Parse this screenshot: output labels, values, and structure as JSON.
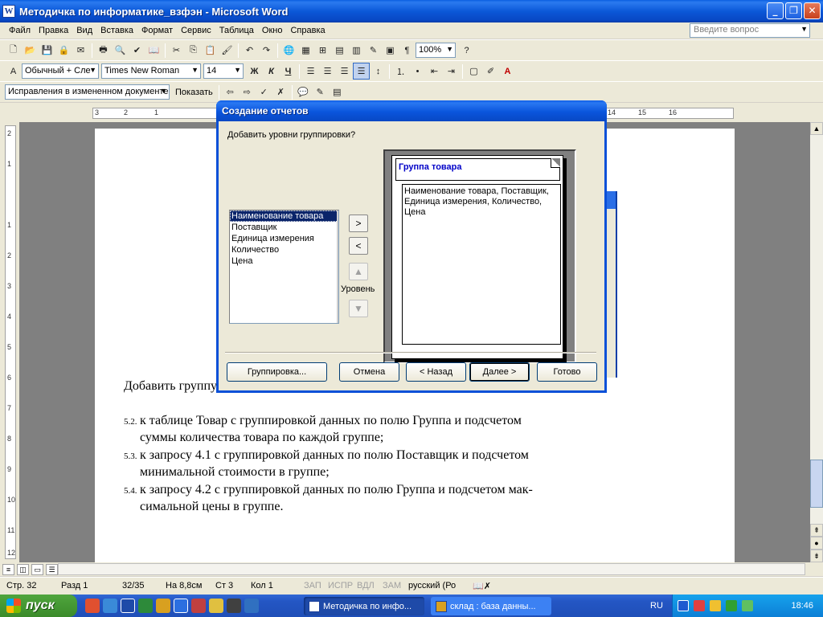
{
  "window": {
    "title": "Методичка по информатике_взфэн - Microsoft Word",
    "app_icon": "W",
    "controls": [
      "_",
      "❐",
      "✕"
    ]
  },
  "menu": {
    "items": [
      "Файл",
      "Правка",
      "Вид",
      "Вставка",
      "Формат",
      "Сервис",
      "Таблица",
      "Окно",
      "Справка"
    ],
    "help_placeholder": "Введите вопрос"
  },
  "toolbar1": {
    "zoom": "100%"
  },
  "toolbar2": {
    "style": "Обычный + Сле",
    "font": "Times New Roman",
    "size": "14",
    "bold": "Ж",
    "italic": "К",
    "underline": "Ч"
  },
  "toolbar3": {
    "track_changes": "Исправления в измененном документе",
    "show_label": "Показать"
  },
  "ruler": {
    "h_numbers": [
      "3",
      "2",
      "1",
      "14",
      "15",
      "16"
    ],
    "v_numbers": [
      "2",
      "1",
      "1",
      "2",
      "3",
      "4",
      "5",
      "6",
      "7",
      "8",
      "9",
      "10",
      "11",
      "12"
    ]
  },
  "document": {
    "cutoff_line": "Добавить группу товара в уровень группировки",
    "items": [
      {
        "num": "5.2.",
        "line1": "к таблице Товар с группировкой данных по полю Группа и подсчетом",
        "line2": "суммы количества товара по каждой группе;"
      },
      {
        "num": "5.3.",
        "line1": "к запросу 4.1  с группировкой данных по полю Поставщик и подсчетом",
        "line2": "минимальной стоимости в группе;"
      },
      {
        "num": "5.4.",
        "line1": "к запросу 4.2 с группировкой данных по полю Группа и подсчетом мак-",
        "line2": "симальной цены в группе."
      }
    ]
  },
  "status": {
    "page": "Стр. 32",
    "section": "Разд 1",
    "pages": "32/35",
    "at": "На 8,8см",
    "line": "Ст 3",
    "col": "Кол 1",
    "rec": "ЗАП",
    "trk": "ИСПР",
    "ext": "ВДЛ",
    "ovr": "ЗАМ",
    "lang": "русский (Ро"
  },
  "taskbar": {
    "start": "пуск",
    "tasks": [
      "Методичка по инфо...",
      "склад : база данны..."
    ],
    "lang": "RU",
    "clock": "18:46"
  },
  "wizard": {
    "title": "Создание отчетов",
    "prompt": "Добавить уровни группировки?",
    "fields": [
      "Наименование товара",
      "Поставщик",
      "Единица измерения",
      "Количество",
      "Цена"
    ],
    "add": ">",
    "remove": "<",
    "level_label": "Уровень",
    "group_header": "Группа товара",
    "detail_text": "Наименование товара, Поставщик, Единица измерения, Количество, Цена",
    "buttons": {
      "grouping": "Группировка...",
      "cancel": "Отмена",
      "back": "< Назад",
      "next": "Далее >",
      "finish": "Готово"
    }
  },
  "colors": {
    "titlebar": "#0b58d8",
    "selection": "#0a246a",
    "group_header_text": "#0000c8"
  }
}
